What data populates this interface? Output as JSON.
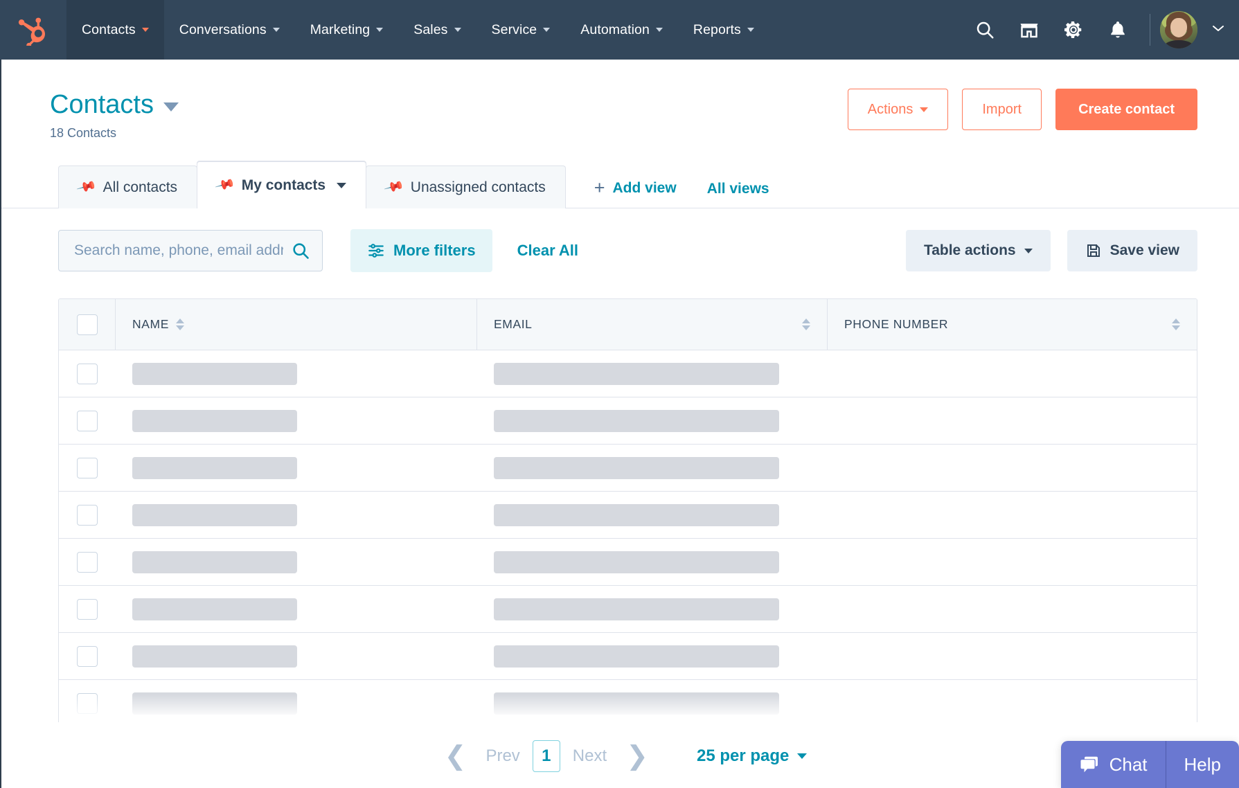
{
  "nav": {
    "logo": "hubspot-sprocket-logo",
    "items": [
      {
        "label": "Contacts",
        "active": true
      },
      {
        "label": "Conversations",
        "active": false
      },
      {
        "label": "Marketing",
        "active": false
      },
      {
        "label": "Sales",
        "active": false
      },
      {
        "label": "Service",
        "active": false
      },
      {
        "label": "Automation",
        "active": false
      },
      {
        "label": "Reports",
        "active": false
      }
    ],
    "icons": [
      "search-icon",
      "marketplace-icon",
      "gear-icon",
      "bell-icon"
    ],
    "avatar_alt": "user-avatar"
  },
  "header": {
    "title": "Contacts",
    "count": "18 Contacts",
    "actions_label": "Actions",
    "import_label": "Import",
    "create_label": "Create contact"
  },
  "tabs": {
    "items": [
      {
        "label": "All contacts",
        "active": false,
        "has_caret": false
      },
      {
        "label": "My contacts",
        "active": true,
        "has_caret": true
      },
      {
        "label": "Unassigned contacts",
        "active": false,
        "has_caret": false
      }
    ],
    "add_view": "Add view",
    "all_views": "All views"
  },
  "toolbar": {
    "search_placeholder": "Search name, phone, email address, or company name",
    "search_value": "",
    "more_filters": "More filters",
    "clear_all": "Clear All",
    "table_actions": "Table actions",
    "save_view": "Save view"
  },
  "table": {
    "columns": [
      {
        "label": "NAME",
        "sortable": true
      },
      {
        "label": "EMAIL",
        "sortable": true
      },
      {
        "label": "PHONE NUMBER",
        "sortable": true
      }
    ],
    "loading": true,
    "row_count": 8
  },
  "pagination": {
    "prev": "Prev",
    "current_page": "1",
    "next": "Next",
    "per_page": "25 per page"
  },
  "chat": {
    "chat_label": "Chat",
    "help_label": "Help"
  },
  "colors": {
    "nav_bg": "#33475b",
    "nav_active_bg": "#2c3e50",
    "brand_orange": "#ff7a59",
    "teal": "#0091ae",
    "slate": "#33475b",
    "border": "#dfe3eb",
    "skeleton": "#d6d9df",
    "chat_purple": "#6a78d1"
  }
}
